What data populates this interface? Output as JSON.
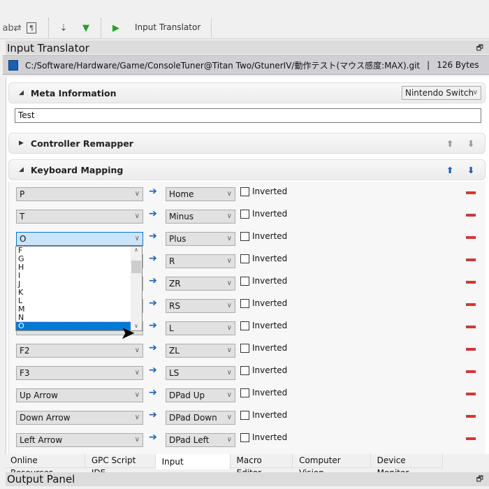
{
  "toolbar": {
    "run_label": "Input Translator",
    "icons": [
      "replace-icon",
      "paragraph-icon",
      "download-device-icon",
      "device-program-icon",
      "run-icon"
    ]
  },
  "panel": {
    "title": "Input Translator",
    "path": "C:/Software/Hardware/Game/ConsoleTuner@Titan Two/GtunerIV/動作テスト(マウス感度:MAX).git",
    "size": "126 Bytes"
  },
  "meta": {
    "title": "Meta Information",
    "console": "Nintendo Switch",
    "name": "Test"
  },
  "remapper": {
    "title": "Controller Remapper"
  },
  "keyboard": {
    "title": "Keyboard Mapping",
    "inverted_label": "Inverted",
    "rows": [
      {
        "key": "P",
        "target": "Home"
      },
      {
        "key": "T",
        "target": "Minus"
      },
      {
        "key": "O",
        "target": "Plus"
      },
      {
        "key": "",
        "target": "R"
      },
      {
        "key": "",
        "target": "ZR"
      },
      {
        "key": "",
        "target": "RS"
      },
      {
        "key": "",
        "target": "L"
      },
      {
        "key": "F2",
        "target": "ZL"
      },
      {
        "key": "F3",
        "target": "LS"
      },
      {
        "key": "Up Arrow",
        "target": "DPad Up"
      },
      {
        "key": "Down Arrow",
        "target": "DPad Down"
      },
      {
        "key": "Left Arrow",
        "target": "DPad Left"
      }
    ],
    "dropdown": {
      "items": [
        "F",
        "G",
        "H",
        "I",
        "J",
        "K",
        "L",
        "M",
        "N",
        "O"
      ],
      "selected": "O"
    }
  },
  "tabs": [
    "Online Resources",
    "GPC Script IDE",
    "Input Translator",
    "Macro Editor",
    "Computer Vision",
    "Device Monitor"
  ],
  "active_tab": "Input Translator",
  "output": {
    "title": "Output Panel"
  },
  "colors": {
    "accent": "#0078d7",
    "remove": "#d03838",
    "arrow": "#1a5fb4"
  }
}
